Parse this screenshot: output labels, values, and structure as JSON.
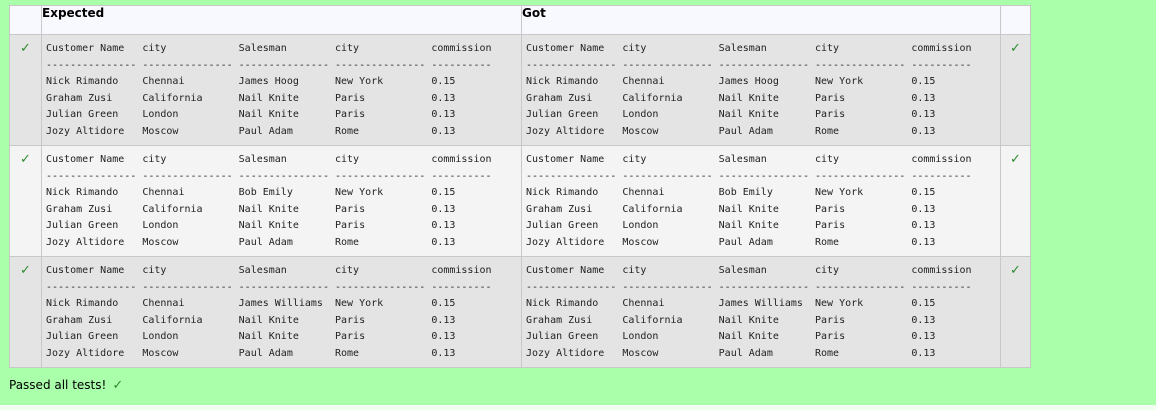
{
  "results": {
    "headers": {
      "expected": "Expected",
      "got": "Got"
    },
    "rows": [
      {
        "expected": "Customer Name   city            Salesman        city            commission\n--------------- --------------- --------------- --------------- ----------\nNick Rimando    Chennai         James Hoog      New York        0.15\nGraham Zusi     California      Nail Knite      Paris           0.13\nJulian Green    London          Nail Knite      Paris           0.13\nJozy Altidore   Moscow          Paul Adam       Rome            0.13",
        "got": "Customer Name   city            Salesman        city            commission\n--------------- --------------- --------------- --------------- ----------\nNick Rimando    Chennai         James Hoog      New York        0.15\nGraham Zusi     California      Nail Knite      Paris           0.13\nJulian Green    London          Nail Knite      Paris           0.13\nJozy Altidore   Moscow          Paul Adam       Rome            0.13",
        "pass_icon_left": "✓",
        "pass_icon_right": "✓"
      },
      {
        "expected": "Customer Name   city            Salesman        city            commission\n--------------- --------------- --------------- --------------- ----------\nNick Rimando    Chennai         Bob Emily       New York        0.15\nGraham Zusi     California      Nail Knite      Paris           0.13\nJulian Green    London          Nail Knite      Paris           0.13\nJozy Altidore   Moscow          Paul Adam       Rome            0.13",
        "got": "Customer Name   city            Salesman        city            commission\n--------------- --------------- --------------- --------------- ----------\nNick Rimando    Chennai         Bob Emily       New York        0.15\nGraham Zusi     California      Nail Knite      Paris           0.13\nJulian Green    London          Nail Knite      Paris           0.13\nJozy Altidore   Moscow          Paul Adam       Rome            0.13",
        "pass_icon_left": "✓",
        "pass_icon_right": "✓"
      },
      {
        "expected": "Customer Name   city            Salesman        city            commission\n--------------- --------------- --------------- --------------- ----------\nNick Rimando    Chennai         James Williams  New York        0.15\nGraham Zusi     California      Nail Knite      Paris           0.13\nJulian Green    London          Nail Knite      Paris           0.13\nJozy Altidore   Moscow          Paul Adam       Rome            0.13",
        "got": "Customer Name   city            Salesman        city            commission\n--------------- --------------- --------------- --------------- ----------\nNick Rimando    Chennai         James Williams  New York        0.15\nGraham Zusi     California      Nail Knite      Paris           0.13\nJulian Green    London          Nail Knite      Paris           0.13\nJozy Altidore   Moscow          Paul Adam       Rome            0.13",
        "pass_icon_left": "✓",
        "pass_icon_right": "✓"
      }
    ]
  },
  "status": {
    "text": "Passed all tests!",
    "icon": "✓"
  },
  "colors": {
    "page_bg": "#aaffaa",
    "check": "#2e8b2e"
  }
}
